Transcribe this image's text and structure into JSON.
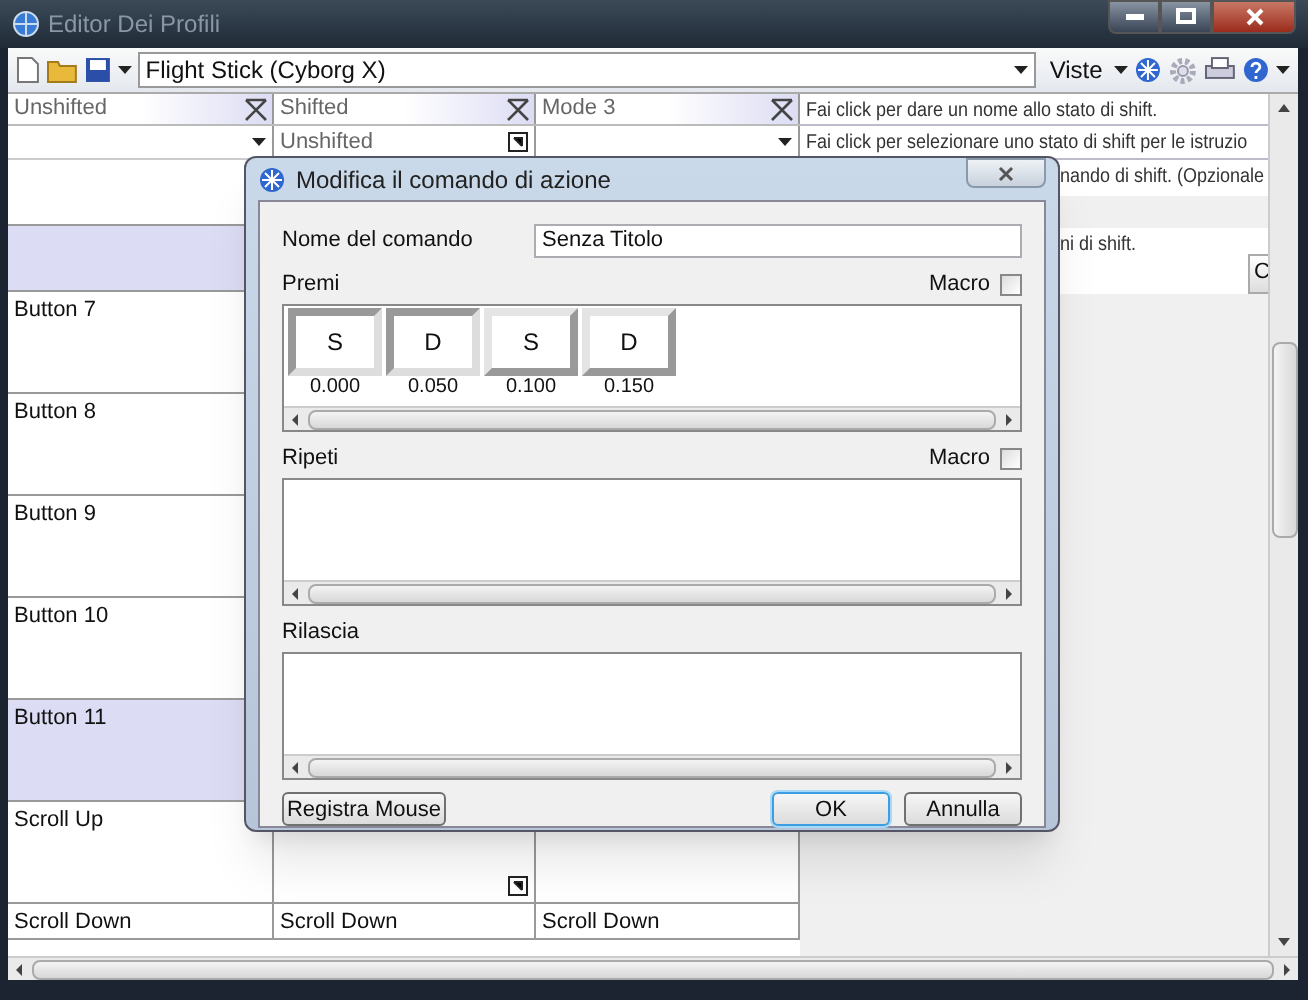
{
  "window": {
    "title": "Editor Dei Profili"
  },
  "toolbar": {
    "profile": "Flight Stick (Cyborg X)",
    "views": "Viste"
  },
  "grid": {
    "columns": [
      {
        "name": "Unshifted",
        "kind": "dropdown"
      },
      {
        "name": "Shifted",
        "shift": "Unshifted",
        "kind": "link"
      },
      {
        "name": "Mode 3",
        "kind": "dropdown"
      }
    ],
    "rows": [
      {
        "kind": "blank",
        "selected": false
      },
      {
        "kind": "blank",
        "selected": true
      },
      {
        "kind": "item",
        "cells": [
          "Button 7"
        ],
        "selected": false
      },
      {
        "kind": "item",
        "cells": [
          "Button 8"
        ],
        "selected": false
      },
      {
        "kind": "item",
        "cells": [
          "Button 9"
        ],
        "selected": false
      },
      {
        "kind": "item",
        "cells": [
          "Button 10"
        ],
        "selected": false
      },
      {
        "kind": "item",
        "cells": [
          "Button 11"
        ],
        "selected": true
      },
      {
        "kind": "item",
        "cells": [
          "Scroll Up"
        ],
        "selected": false,
        "linked": true
      },
      {
        "kind": "short",
        "cells": [
          "Scroll Down",
          "Scroll Down",
          "Scroll Down"
        ],
        "selected": false,
        "linked": false
      }
    ]
  },
  "info": {
    "lines": [
      "Fai click per dare un nome allo stato di shift.",
      "Fai click per selezionare uno stato di shift per le istruzio",
      "nando di shift. (Opzionale",
      "ni di shift."
    ],
    "button": "C"
  },
  "dialog": {
    "title": "Modifica il comando di azione",
    "name_label": "Nome del comando",
    "name_value": "Senza Titolo",
    "sections": [
      {
        "label": "Premi",
        "macro_label": "Macro",
        "macro_checked": false,
        "keys": [
          {
            "key": "S",
            "time": "0.000",
            "pressed": true
          },
          {
            "key": "D",
            "time": "0.050",
            "pressed": true
          },
          {
            "key": "S",
            "time": "0.100",
            "pressed": false
          },
          {
            "key": "D",
            "time": "0.150",
            "pressed": false
          }
        ]
      },
      {
        "label": "Ripeti",
        "macro_label": "Macro",
        "macro_checked": false
      },
      {
        "label": "Rilascia"
      }
    ],
    "buttons": [
      {
        "label": "Registra Mouse",
        "default": false
      },
      {
        "label": "OK",
        "default": true
      },
      {
        "label": "Annulla",
        "default": false
      }
    ]
  }
}
